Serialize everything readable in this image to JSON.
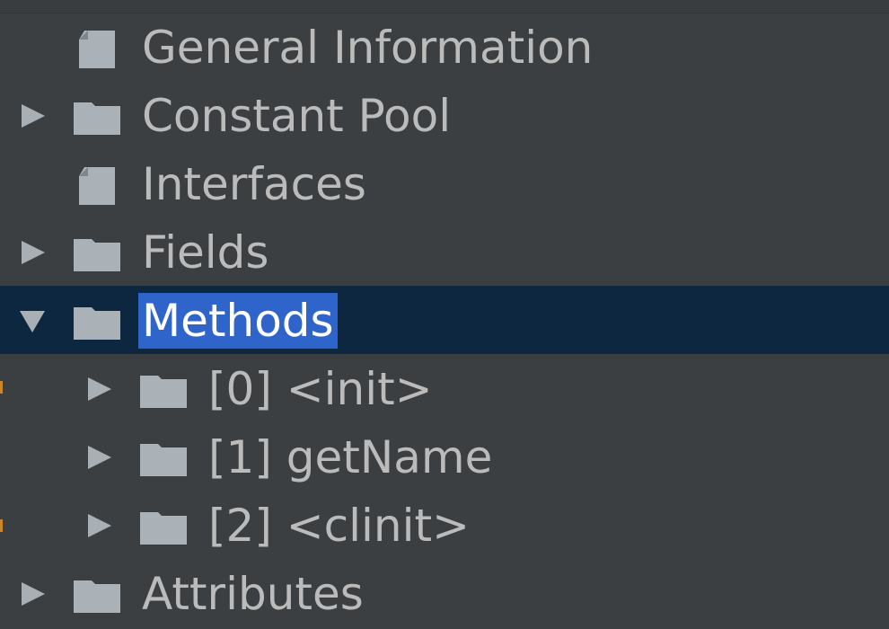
{
  "tree": {
    "nodes": [
      {
        "label": "General Information",
        "icon": "file-icon",
        "expandable": false,
        "expanded": false,
        "depth": 0,
        "selected": false
      },
      {
        "label": "Constant Pool",
        "icon": "folder-icon",
        "expandable": true,
        "expanded": false,
        "depth": 0,
        "selected": false
      },
      {
        "label": "Interfaces",
        "icon": "file-icon",
        "expandable": false,
        "expanded": false,
        "depth": 0,
        "selected": false
      },
      {
        "label": "Fields",
        "icon": "folder-icon",
        "expandable": true,
        "expanded": false,
        "depth": 0,
        "selected": false
      },
      {
        "label": "Methods",
        "icon": "folder-icon",
        "expandable": true,
        "expanded": true,
        "depth": 0,
        "selected": true
      },
      {
        "label": "[0] <init>",
        "icon": "folder-icon",
        "expandable": true,
        "expanded": false,
        "depth": 1,
        "selected": false
      },
      {
        "label": "[1] getName",
        "icon": "folder-icon",
        "expandable": true,
        "expanded": false,
        "depth": 1,
        "selected": false
      },
      {
        "label": "[2] <clinit>",
        "icon": "folder-icon",
        "expandable": true,
        "expanded": false,
        "depth": 1,
        "selected": false
      },
      {
        "label": "Attributes",
        "icon": "folder-icon",
        "expandable": true,
        "expanded": false,
        "depth": 0,
        "selected": false
      }
    ]
  },
  "colors": {
    "background": "#3c3f41",
    "selected_row": "#0d2740",
    "selected_label": "#2f65ca",
    "text": "#bbbbbb",
    "icon": "#aab2b8"
  }
}
